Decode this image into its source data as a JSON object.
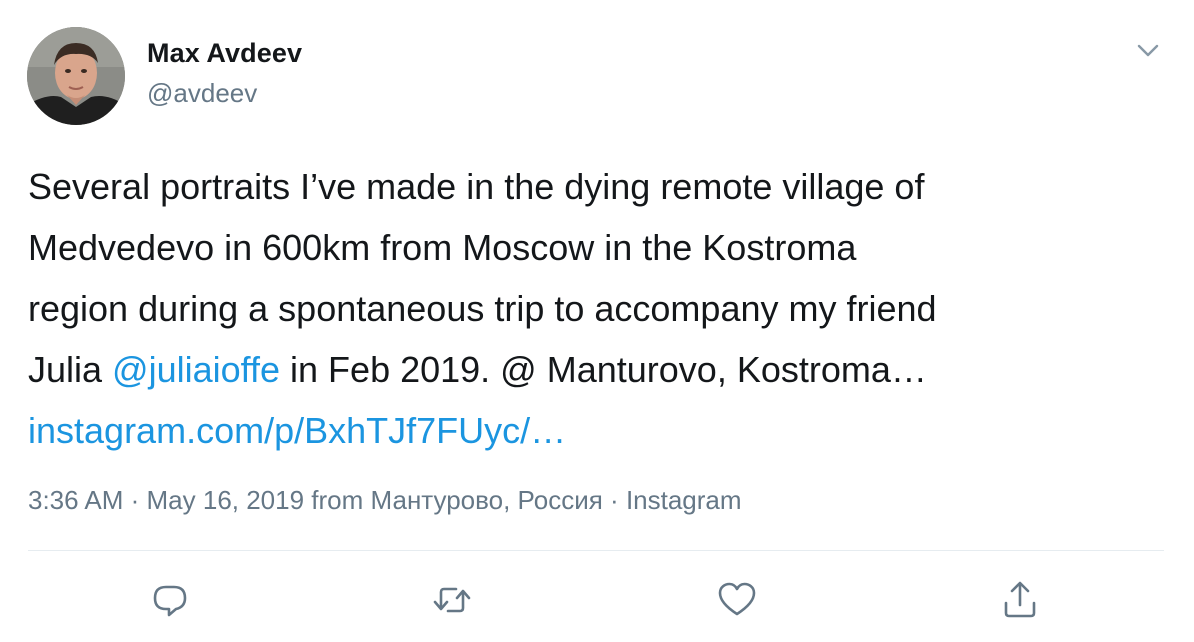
{
  "author": {
    "name": "Max Avdeev",
    "handle": "@avdeev"
  },
  "tweet": {
    "line1": "Several portraits I’ve made in the dying remote village of",
    "line2": "Medvedevo in 600km from Moscow in the Kostroma",
    "line3": "region during a spontaneous trip to accompany my friend",
    "line4_prefix": "Julia ",
    "mention": "@juliaioffe",
    "line4_suffix": " in Feb 2019. @ Manturovo, Kostroma…",
    "link": "instagram.com/p/BxhTJf7FUyc/…"
  },
  "meta": {
    "time": "3:36 AM",
    "separator1": " · ",
    "date": "May 16, 2019",
    "from_word": " from ",
    "location": "Мантурово, Россия",
    "separator2": " · ",
    "source": "Instagram"
  },
  "actions": {
    "reply_icon": "reply-icon",
    "retweet_icon": "retweet-icon",
    "like_icon": "heart-icon",
    "share_icon": "share-icon"
  },
  "colors": {
    "text": "#14171a",
    "secondary": "#657786",
    "link": "#1b95e0",
    "divider": "#e6ecf0"
  }
}
